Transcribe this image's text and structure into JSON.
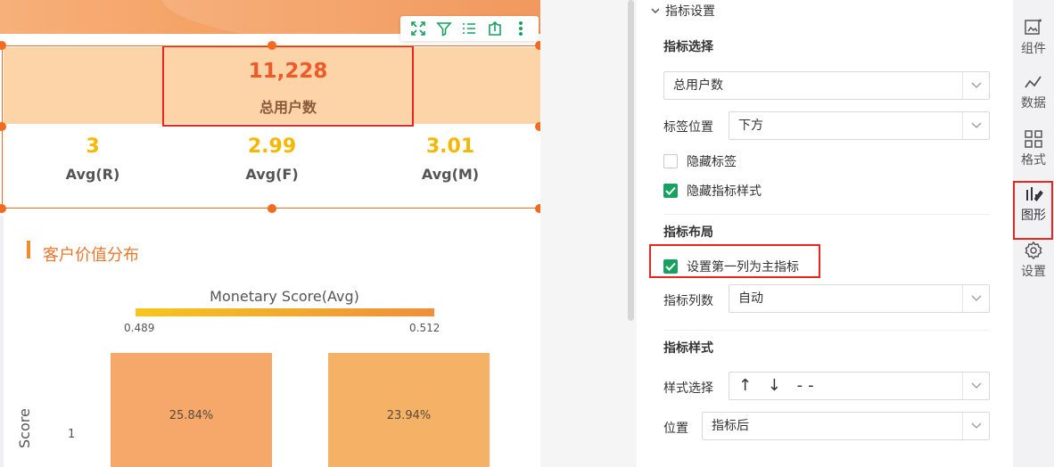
{
  "kpi": {
    "main": {
      "value": "11,228",
      "label": "总用户数"
    },
    "subs": [
      {
        "value": "3",
        "label": "Avg(R)"
      },
      {
        "value": "2.99",
        "label": "Avg(F)"
      },
      {
        "value": "3.01",
        "label": "Avg(M)"
      }
    ]
  },
  "toolbar": {
    "icons": [
      "expand-icon",
      "filter-icon",
      "list-icon",
      "export-icon",
      "more-icon"
    ]
  },
  "chart": {
    "title": "客户价值分布",
    "legend_title": "Monetary Score(Avg)",
    "legend_min": "0.489",
    "legend_max": "0.512",
    "row_label": "1",
    "axis_label": "Score",
    "cells": [
      {
        "label": "25.84%",
        "color": "#f5a86a"
      },
      {
        "label": "23.94%",
        "color": "#f5b266"
      }
    ]
  },
  "panel": {
    "section": "指标设置",
    "indicator_select": {
      "title": "指标选择",
      "value": "总用户数"
    },
    "label_position": {
      "label": "标签位置",
      "value": "下方"
    },
    "hide_label": {
      "label": "隐藏标签",
      "checked": false
    },
    "hide_style": {
      "label": "隐藏指标样式",
      "checked": true
    },
    "layout": {
      "title": "指标布局",
      "first_main": "设置第一列为主指标",
      "columns_label": "指标列数",
      "columns_value": "自动"
    },
    "style": {
      "title": "指标样式",
      "select_label": "样式选择",
      "select_value": "↑ ↓ --",
      "position_label": "位置",
      "position_value": "指标后"
    }
  },
  "rail": {
    "items": [
      {
        "label": "组件",
        "icon": "component-icon"
      },
      {
        "label": "数据",
        "icon": "data-icon"
      },
      {
        "label": "格式",
        "icon": "format-icon"
      },
      {
        "label": "图形",
        "icon": "shape-icon"
      },
      {
        "label": "设置",
        "icon": "settings-icon"
      }
    ]
  },
  "colors": {
    "accent": "#f26b1e",
    "highlight": "#e8251f",
    "check": "#19a15f"
  }
}
